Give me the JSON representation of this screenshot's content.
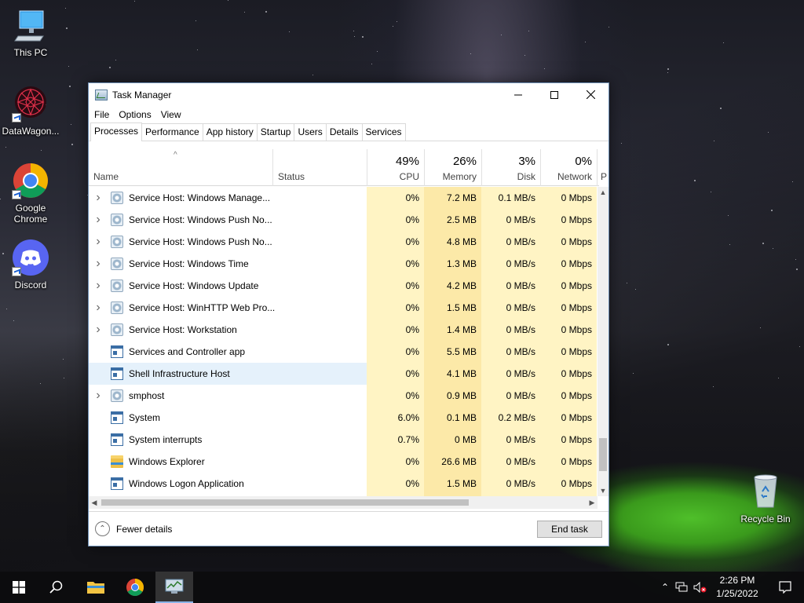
{
  "desktop": {
    "icons": [
      {
        "label": "This PC"
      },
      {
        "label": "DataWagon..."
      },
      {
        "label": "Google Chrome"
      },
      {
        "label": "Discord"
      },
      {
        "label": "Recycle Bin"
      }
    ]
  },
  "window": {
    "title": "Task Manager",
    "menu": [
      "File",
      "Options",
      "View"
    ],
    "tabs": [
      "Processes",
      "Performance",
      "App history",
      "Startup",
      "Users",
      "Details",
      "Services"
    ],
    "active_tab": "Processes",
    "columns": {
      "name": "Name",
      "status": "Status",
      "cpu": {
        "pct": "49%",
        "label": "CPU"
      },
      "memory": {
        "pct": "26%",
        "label": "Memory"
      },
      "disk": {
        "pct": "3%",
        "label": "Disk"
      },
      "network": {
        "pct": "0%",
        "label": "Network"
      },
      "power": "P"
    },
    "rows": [
      {
        "name": "Service Host: Windows Manage...",
        "expandable": true,
        "icon": "gear-icon",
        "cpu": "0%",
        "memory": "7.2 MB",
        "disk": "0.1 MB/s",
        "network": "0 Mbps"
      },
      {
        "name": "Service Host: Windows Push No...",
        "expandable": true,
        "icon": "gear-icon",
        "cpu": "0%",
        "memory": "2.5 MB",
        "disk": "0 MB/s",
        "network": "0 Mbps"
      },
      {
        "name": "Service Host: Windows Push No...",
        "expandable": true,
        "icon": "gear-icon",
        "cpu": "0%",
        "memory": "4.8 MB",
        "disk": "0 MB/s",
        "network": "0 Mbps"
      },
      {
        "name": "Service Host: Windows Time",
        "expandable": true,
        "icon": "gear-icon",
        "cpu": "0%",
        "memory": "1.3 MB",
        "disk": "0 MB/s",
        "network": "0 Mbps"
      },
      {
        "name": "Service Host: Windows Update",
        "expandable": true,
        "icon": "gear-icon",
        "cpu": "0%",
        "memory": "4.2 MB",
        "disk": "0 MB/s",
        "network": "0 Mbps"
      },
      {
        "name": "Service Host: WinHTTP Web Pro...",
        "expandable": true,
        "icon": "gear-icon",
        "cpu": "0%",
        "memory": "1.5 MB",
        "disk": "0 MB/s",
        "network": "0 Mbps"
      },
      {
        "name": "Service Host: Workstation",
        "expandable": true,
        "icon": "gear-icon",
        "cpu": "0%",
        "memory": "1.4 MB",
        "disk": "0 MB/s",
        "network": "0 Mbps"
      },
      {
        "name": "Services and Controller app",
        "expandable": false,
        "icon": "app-window-icon",
        "cpu": "0%",
        "memory": "5.5 MB",
        "disk": "0 MB/s",
        "network": "0 Mbps"
      },
      {
        "name": "Shell Infrastructure Host",
        "expandable": false,
        "icon": "app-window-icon",
        "cpu": "0%",
        "memory": "4.1 MB",
        "disk": "0 MB/s",
        "network": "0 Mbps",
        "selected": true
      },
      {
        "name": "smphost",
        "expandable": true,
        "icon": "gear-icon",
        "cpu": "0%",
        "memory": "0.9 MB",
        "disk": "0 MB/s",
        "network": "0 Mbps"
      },
      {
        "name": "System",
        "expandable": false,
        "icon": "app-window-icon",
        "cpu": "6.0%",
        "memory": "0.1 MB",
        "disk": "0.2 MB/s",
        "network": "0 Mbps"
      },
      {
        "name": "System interrupts",
        "expandable": false,
        "icon": "app-window-icon",
        "cpu": "0.7%",
        "memory": "0 MB",
        "disk": "0 MB/s",
        "network": "0 Mbps"
      },
      {
        "name": "Windows Explorer",
        "expandable": false,
        "icon": "folder-icon",
        "cpu": "0%",
        "memory": "26.6 MB",
        "disk": "0 MB/s",
        "network": "0 Mbps"
      },
      {
        "name": "Windows Logon Application",
        "expandable": false,
        "icon": "app-window-icon",
        "cpu": "0%",
        "memory": "1.5 MB",
        "disk": "0 MB/s",
        "network": "0 Mbps"
      }
    ],
    "footer": {
      "fewer_details": "Fewer details",
      "end_task": "End task"
    }
  },
  "taskbar": {
    "clock": {
      "time": "2:26 PM",
      "date": "1/25/2022"
    }
  }
}
